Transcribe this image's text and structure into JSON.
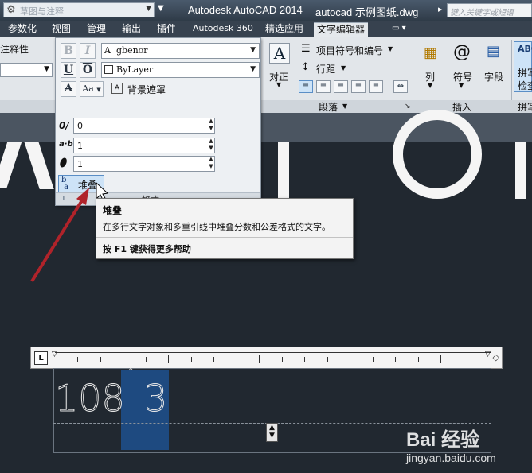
{
  "title_bar": {
    "workspace": "草图与注释",
    "app_title": "Autodesk AutoCAD 2014",
    "file_name": "autocad 示例图纸.dwg",
    "search_placeholder": "键入关键字或短语"
  },
  "tabs": [
    "参数化",
    "视图",
    "管理",
    "输出",
    "插件",
    "Autodesk 360",
    "精选应用",
    "文字编辑器"
  ],
  "active_tab": "文字编辑器",
  "ribbon": {
    "annotative_label": "注释性",
    "paragraph": {
      "justify_label": "对正",
      "bullets_label": "项目符号和编号",
      "line_spacing_label": "行距",
      "group_title": "段落"
    },
    "insert": {
      "columns_label": "列",
      "symbol_label": "符号",
      "field_label": "字段",
      "group_title": "插入"
    },
    "spell": {
      "label_line1": "拼写",
      "label_line2": "检查",
      "group_title": "拼写"
    }
  },
  "format_panel": {
    "bold": "B",
    "italic": "I",
    "underline": "U",
    "overline": "O",
    "strikethrough": "A",
    "case_label": "Aa",
    "font": "gbenor",
    "color": "ByLayer",
    "background_mask": "背景遮罩",
    "oblique_value": "0",
    "tracking_value": "1",
    "width_factor_value": "1",
    "stack_label": "堆叠",
    "footer_title": "格式"
  },
  "tooltip": {
    "title": "堆叠",
    "description": "在多行文字对象和多重引线中堆叠分数和公差格式的文字。",
    "help": "按 F1 键获得更多帮助"
  },
  "editor": {
    "ruler_tab_type": "L",
    "text_before": "108",
    "text_selected": "3"
  },
  "watermark": {
    "logo": "Bai 经验",
    "url": "jingyan.baidu.com"
  },
  "colors": {
    "canvas": "#212830",
    "ribbon": "#e2e6ea",
    "selection": "#1e4a80",
    "arrow": "#b0232a"
  }
}
